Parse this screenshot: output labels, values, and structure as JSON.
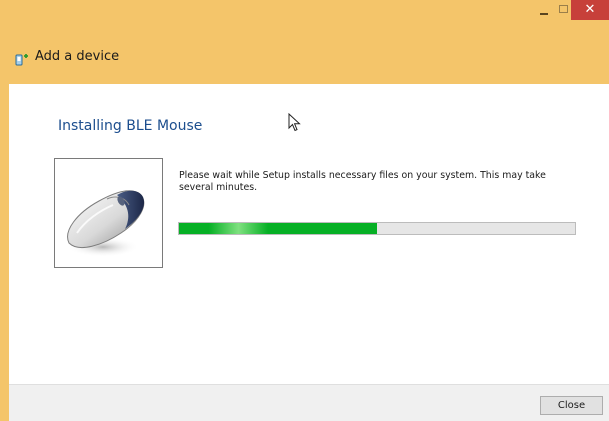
{
  "window": {
    "title": "Add a device",
    "accent_color": "#f4c56a",
    "close_color": "#c7403a",
    "controls": {
      "minimize_icon": "minimize-icon",
      "maximize_icon": "maximize-icon",
      "close_glyph": "✕"
    }
  },
  "main": {
    "heading": "Installing BLE Mouse",
    "message": "Please wait while Setup installs necessary files on your system. This may take several minutes.",
    "device_image": "mouse-image"
  },
  "progress": {
    "fraction": 0.5,
    "fill_color": "#06b025"
  },
  "footer": {
    "close_label": "Close"
  }
}
